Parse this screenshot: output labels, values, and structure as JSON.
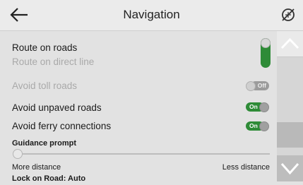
{
  "header": {
    "title": "Navigation",
    "back_icon": "arrow-left-icon",
    "status_icon": "no-gps-icon"
  },
  "options": {
    "route_on_roads": "Route on roads",
    "route_on_direct_line": "Route on direct line",
    "avoid_toll_roads": {
      "label": "Avoid toll roads",
      "state": "Off"
    },
    "avoid_unpaved_roads": {
      "label": "Avoid unpaved roads",
      "state": "On"
    },
    "avoid_ferry_connections": {
      "label": "Avoid ferry connections",
      "state": "On"
    }
  },
  "guidance": {
    "title": "Guidance prompt",
    "left_label": "More distance",
    "right_label": "Less distance",
    "value": 0
  },
  "lock_on_road": "Lock on Road: Auto",
  "colors": {
    "on_green": "#2e8b37",
    "off_grey": "#9b9b9b",
    "background": "#e2e2e2"
  }
}
